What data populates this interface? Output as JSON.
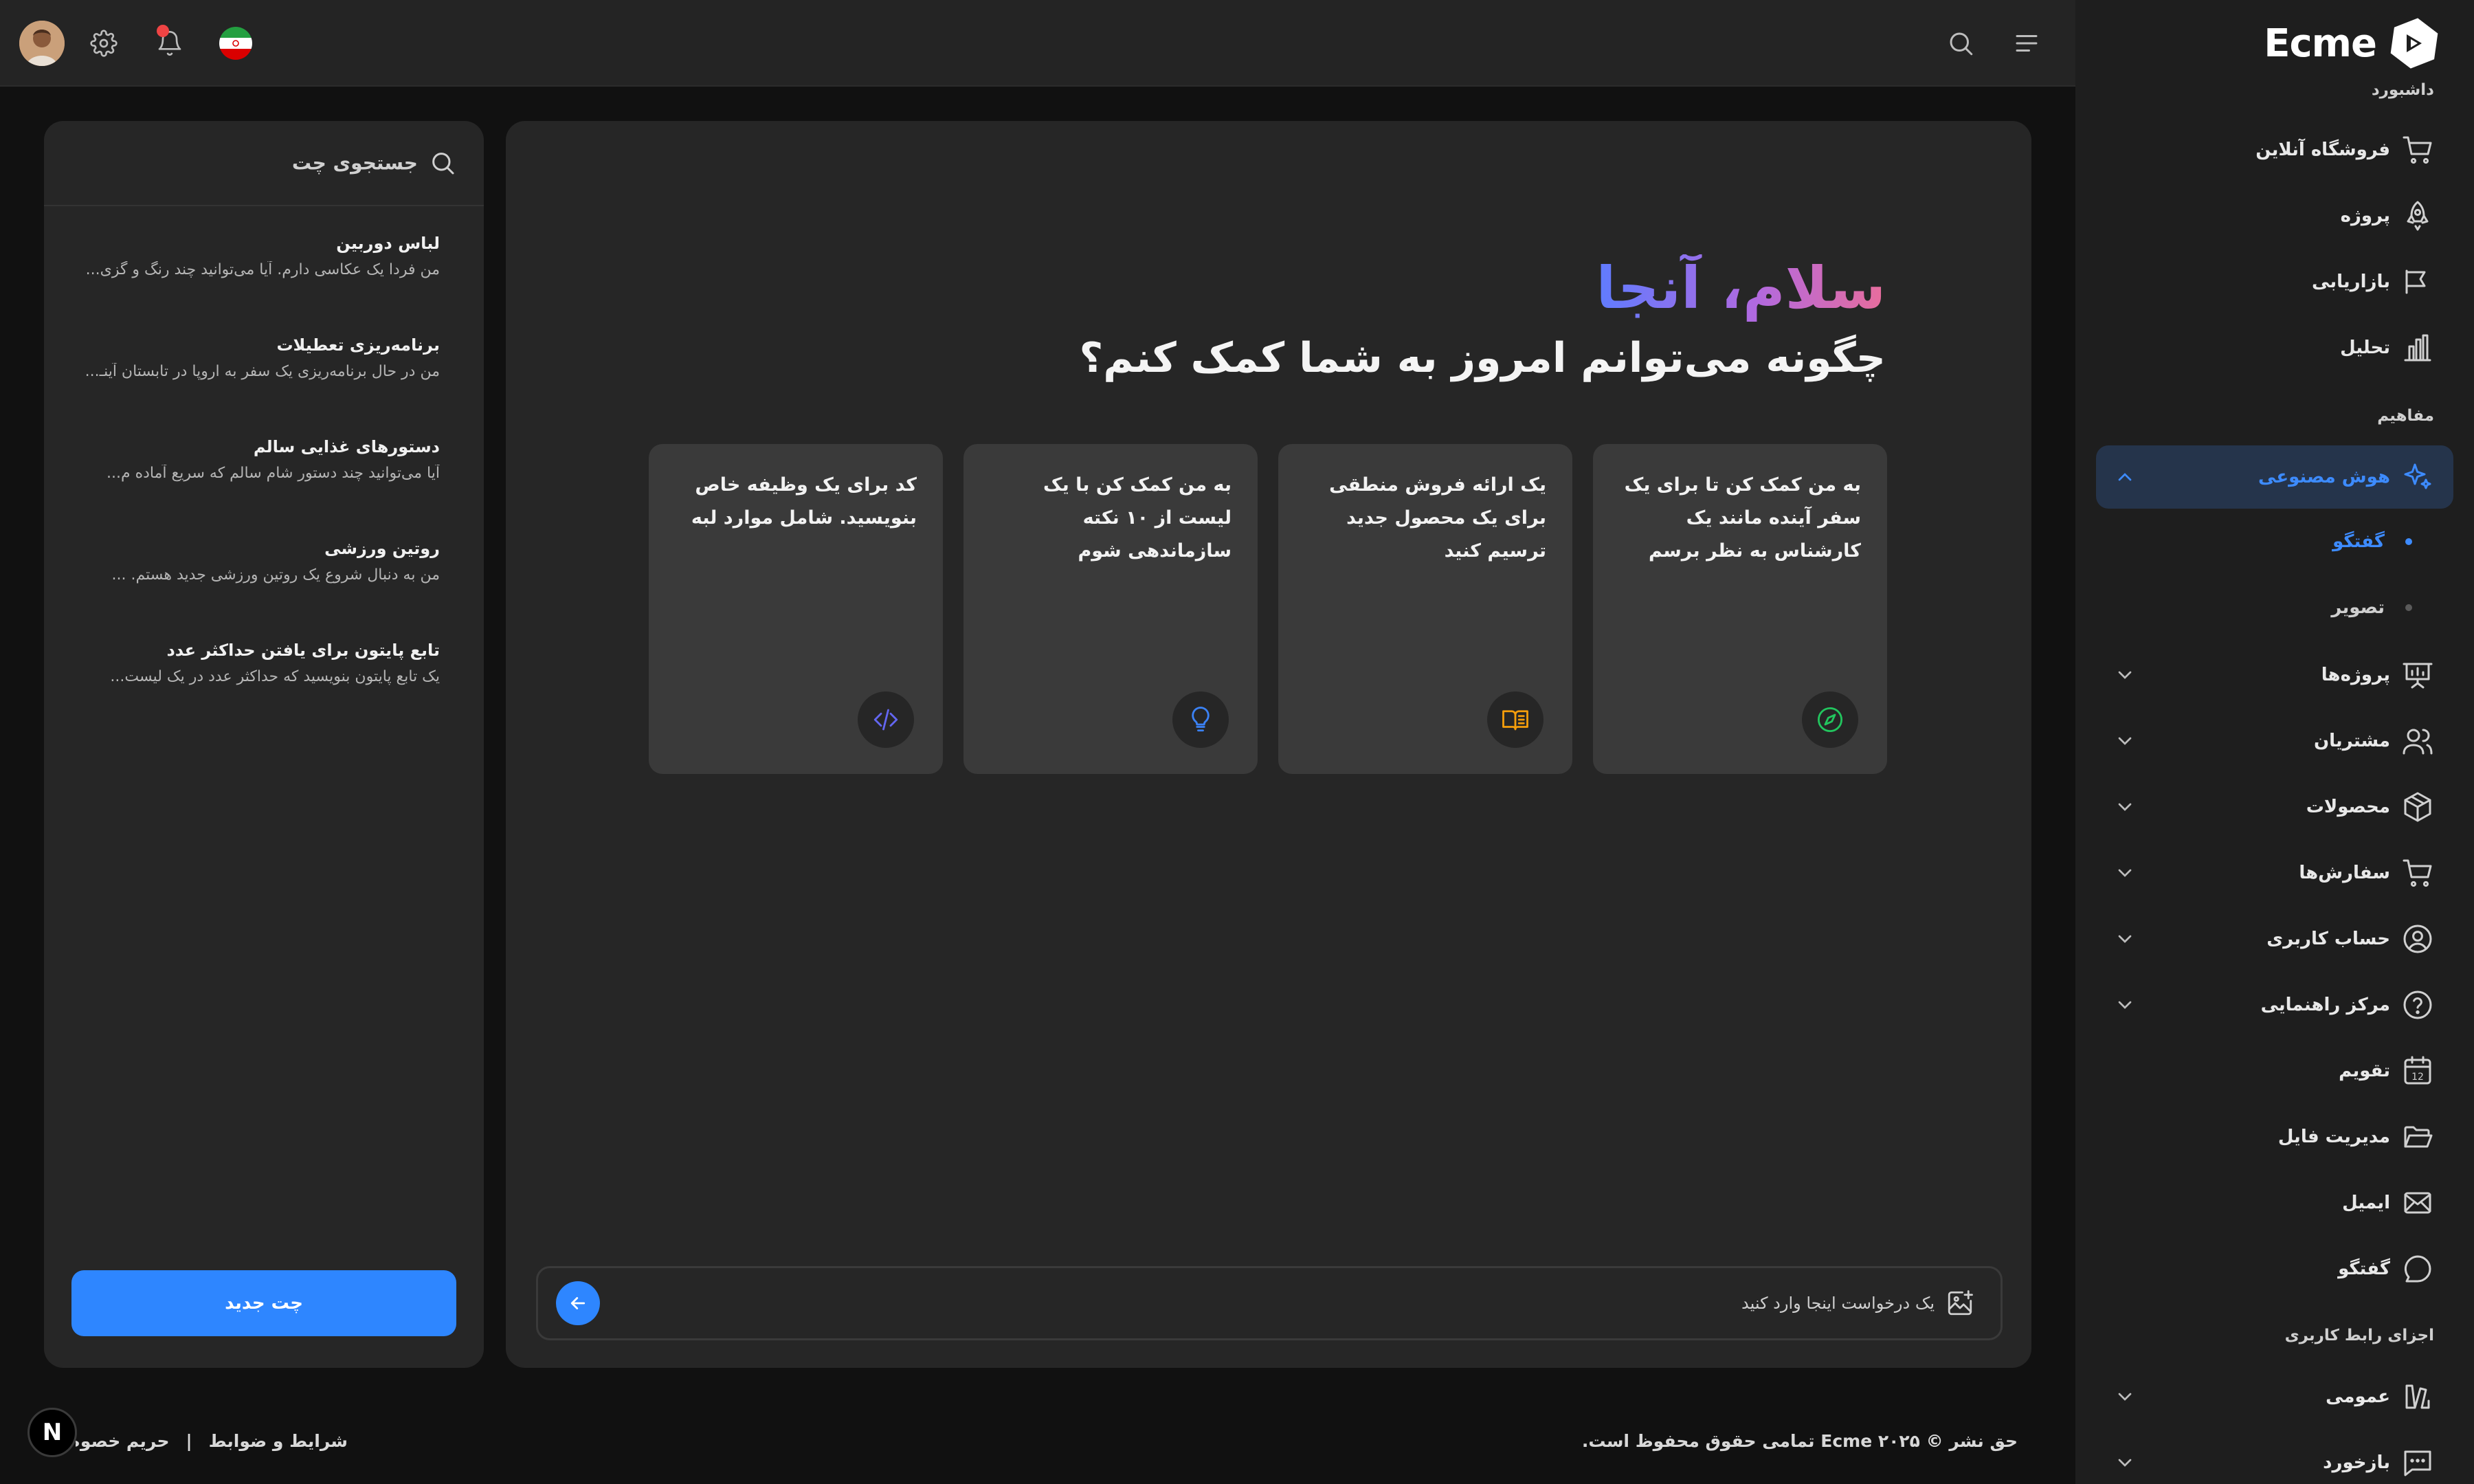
{
  "brand": {
    "name": "Ecme"
  },
  "header": {
    "country": "Iran"
  },
  "sidebar": {
    "sections": {
      "dashboard": "داشبورد",
      "concepts": "مفاهیم",
      "ui_components": "اجزای رابط کاربری"
    },
    "dashboard_items": [
      {
        "label": "فروشگاه آنلاین",
        "icon": "cart-icon"
      },
      {
        "label": "پروژه",
        "icon": "rocket-icon"
      },
      {
        "label": "بازاریابی",
        "icon": "megaphone-icon"
      },
      {
        "label": "تحلیل",
        "icon": "bar-chart-icon"
      }
    ],
    "ai": {
      "label": "هوش مصنوعی",
      "icon": "sparkles-icon"
    },
    "ai_sub": [
      {
        "label": "گفتگو",
        "active": true
      },
      {
        "label": "تصویر",
        "active": false
      }
    ],
    "concept_items": [
      {
        "label": "پروژه‌ها",
        "icon": "presentation-icon"
      },
      {
        "label": "مشتریان",
        "icon": "users-icon"
      },
      {
        "label": "محصولات",
        "icon": "box-icon"
      },
      {
        "label": "سفارش‌ها",
        "icon": "cart-icon"
      },
      {
        "label": "حساب کاربری",
        "icon": "user-circle-icon"
      },
      {
        "label": "مرکز راهنمایی",
        "icon": "help-icon"
      },
      {
        "label": "تقویم",
        "icon": "calendar-icon",
        "calendar_day": "12"
      },
      {
        "label": "مدیریت فایل",
        "icon": "folder-icon"
      },
      {
        "label": "ایمیل",
        "icon": "mail-icon"
      },
      {
        "label": "گفتگو",
        "icon": "chat-bubble-icon"
      }
    ],
    "ui_items": [
      {
        "label": "عمومی",
        "icon": "paint-icon"
      },
      {
        "label": "بازخورد",
        "icon": "feedback-icon"
      }
    ]
  },
  "chat_list": {
    "search_label": "جستجوی چت",
    "items": [
      {
        "title": "لباس دوربین",
        "preview": "من فردا یک عکاسی دارم. آیا می‌توانید چند رنگ و گزی..."
      },
      {
        "title": "برنامه‌ریزی تعطیلات",
        "preview": "من در حال برنامه‌ریزی یک سفر به اروپا در تابستان آینـ..."
      },
      {
        "title": "دستورهای غذایی سالم",
        "preview": "آیا می‌توانید چند دستور شام سالم که سریع آماده م..."
      },
      {
        "title": "روتین ورزشی",
        "preview": "من به دنبال شروع یک روتین ورزشی جدید هستم. ..."
      },
      {
        "title": "تابع پایتون برای یافتن حداکثر عدد",
        "preview": "یک تابع پایتون بنویسید که حداکثر عدد در یک لیست..."
      }
    ],
    "new_chat_label": "چت جدید"
  },
  "main": {
    "greeting": "سلام، آنجا",
    "subtitle": "چگونه می‌توانم امروز به شما کمک کنم؟",
    "cards": [
      {
        "text": "به من کمک کن تا برای یک سفر آینده مانند یک کارشناس به نظر برسم",
        "icon": "compass-icon",
        "color": "#22c55e"
      },
      {
        "text": "یک ارائه فروش منطقی برای یک محصول جدید ترسیم کنید",
        "icon": "book-icon",
        "color": "#f59e0b"
      },
      {
        "text": "به من کمک کن با یک لیست از ۱۰ نکته سازماندهی شوم",
        "icon": "lightbulb-icon",
        "color": "#3b82f6"
      },
      {
        "text": "کد برای یک وظیفه خاص بنویسید. شامل موارد لبه",
        "icon": "code-icon",
        "color": "#6366f1"
      }
    ],
    "prompt_placeholder": "یک درخواست اینجا وارد کنید"
  },
  "footer": {
    "copyright": "حق نشر © ۲۰۲۵ Ecme تمامی حقوق محفوظ است.",
    "terms": "شرایط و ضوابط",
    "privacy": "حریم خصوصی و سیاست"
  },
  "colors": {
    "accent": "#2e86ff",
    "active_bg": "#25344b",
    "background": "#111111"
  }
}
